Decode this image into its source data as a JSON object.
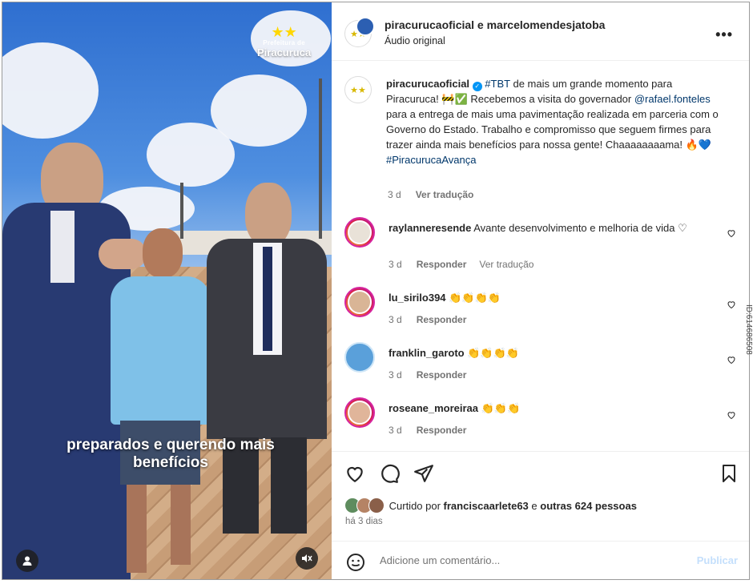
{
  "media": {
    "logo_top": "Prefeitura de",
    "logo_main": "Piracuruca",
    "caption_line1": "preparados e querendo mais",
    "caption_line2": "benefícios",
    "user_icon": "person-icon",
    "mute_icon": "speaker-muted-icon"
  },
  "header": {
    "names": "piracurucaoficial e marcelomendesjatoba",
    "audio": "Áudio original",
    "more": "•••"
  },
  "post_caption": {
    "username": "piracurucaoficial",
    "hashtag1": "#TBT",
    "text1": " de mais um grande momento para Piracuruca! 🚧✅ Recebemos a visita do governador ",
    "mention": "@rafael.fonteles",
    "text2": " para a entrega de mais uma pavimentação realizada em parceria com o Governo do Estado. Trabalho e compromisso que seguem firmes para trazer ainda mais benefícios para nossa gente! Chaaaaaaaama! 🔥💙",
    "hashtag2": "#PiracurucaAvança",
    "time": "3 d",
    "translate": "Ver tradução"
  },
  "comments": [
    {
      "user": "raylanneresende",
      "text": "Avante desenvolvimento e melhoria de vida ♡",
      "time": "3 d",
      "reply": "Responder",
      "translate": "Ver tradução"
    },
    {
      "user": "lu_sirilo394",
      "text": "👏👏👏👏",
      "time": "3 d",
      "reply": "Responder"
    },
    {
      "user": "franklin_garoto",
      "text": "👏👏👏👏",
      "time": "3 d",
      "reply": "Responder"
    },
    {
      "user": "roseane_moreiraa",
      "text": "👏👏👏",
      "time": "3 d",
      "reply": "Responder"
    }
  ],
  "likes": {
    "prefix": "Curtido por ",
    "user": "franciscaarlete63",
    "mid": " e ",
    "others": "outras 624 pessoas"
  },
  "ago": "há 3 dias",
  "add_comment": {
    "placeholder": "Adicione um comentário...",
    "publish": "Publicar"
  },
  "side_id": "ID:614686508",
  "colors": {
    "link": "#00376b",
    "muted": "#737373",
    "verified": "#0095f6",
    "publish_disabled": "#c4dffc"
  }
}
